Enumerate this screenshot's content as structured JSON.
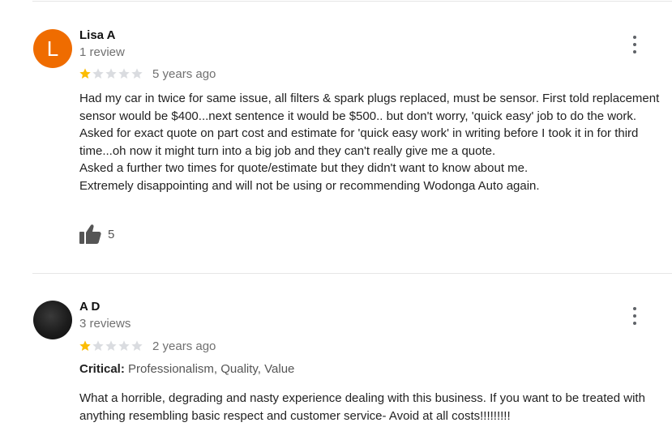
{
  "colors": {
    "star_filled": "#fbbc04",
    "star_empty": "#dadce0",
    "avatar_orange": "#ef6c00",
    "secondary_text": "#707070"
  },
  "reviews": [
    {
      "avatar_letter": "L",
      "name": "Lisa A",
      "review_count": "1 review",
      "rating": 1,
      "time": "5 years ago",
      "paragraphs": [
        "Had my car in twice for same issue, all filters & spark plugs replaced, must be sensor. First told replacement sensor would be $400...next sentence it would be $500.. but don't worry, 'quick easy' job to do the work.",
        "Asked for exact quote on part cost and estimate for 'quick easy work' in writing before I took it in for third time...oh now it might turn into a big job and they can't really give me a quote.",
        "Asked a further two times for quote/estimate but they didn't want to know about me.",
        "Extremely disappointing and will not be using or recommending Wodonga Auto again."
      ],
      "likes": "5"
    },
    {
      "name": "A D",
      "review_count": "3 reviews",
      "rating": 1,
      "time": "2 years ago",
      "critical_label": "Critical:",
      "critical_items": "Professionalism, Quality, Value",
      "paragraphs": [
        "What a horrible, degrading and nasty experience dealing with this business. If you want to be treated with anything resembling basic respect and customer service- Avoid at all costs!!!!!!!!!"
      ]
    }
  ]
}
